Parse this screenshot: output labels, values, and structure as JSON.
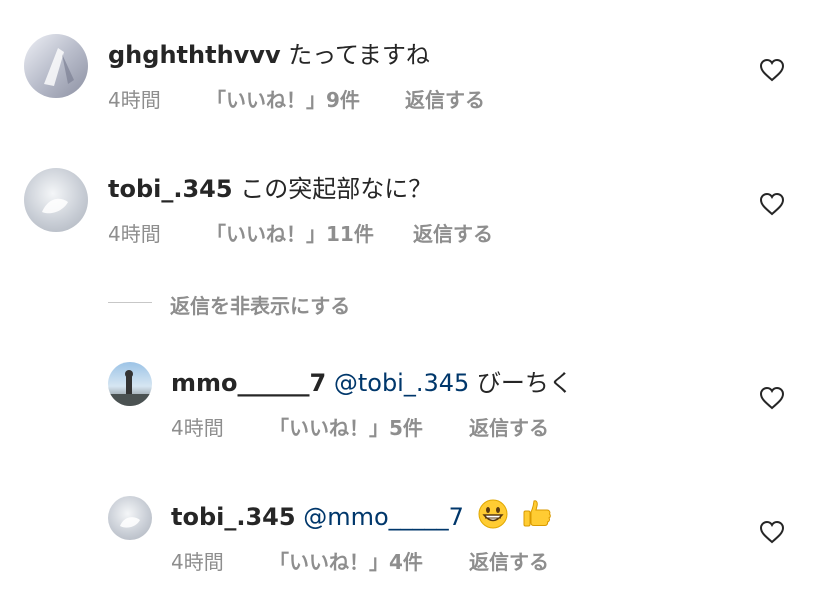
{
  "comments": [
    {
      "username": "ghghththvvv",
      "text": "たってますね",
      "time": "4時間",
      "likes": "「いいね！」9件",
      "reply": "返信する",
      "avatar_icon": "user-avatar-icon",
      "like_icon": "heart-outline-icon"
    },
    {
      "username": "tobi_.345",
      "text": "この突起部なに？",
      "time": "4時間",
      "likes": "「いいね！」11件",
      "reply": "返信する",
      "avatar_icon": "user-avatar-icon",
      "like_icon": "heart-outline-icon"
    }
  ],
  "hide_replies": "返信を非表示にする",
  "replies": [
    {
      "username": "mmo______7",
      "mention": "@tobi_.345",
      "text": "びーちく",
      "time": "4時間",
      "likes": "「いいね！」5件",
      "reply": "返信する",
      "avatar_icon": "user-avatar-icon",
      "like_icon": "heart-outline-icon"
    },
    {
      "username": "tobi_.345",
      "mention": "@mmo_____7",
      "emojis": [
        "grinning-face-emoji",
        "thumbs-up-emoji"
      ],
      "time": "4時間",
      "likes": "「いいね！」4件",
      "reply": "返信する",
      "avatar_icon": "user-avatar-icon",
      "like_icon": "heart-outline-icon"
    }
  ],
  "colors": {
    "text": "#262626",
    "secondary": "#8e8e8e",
    "mention": "#00376b"
  }
}
